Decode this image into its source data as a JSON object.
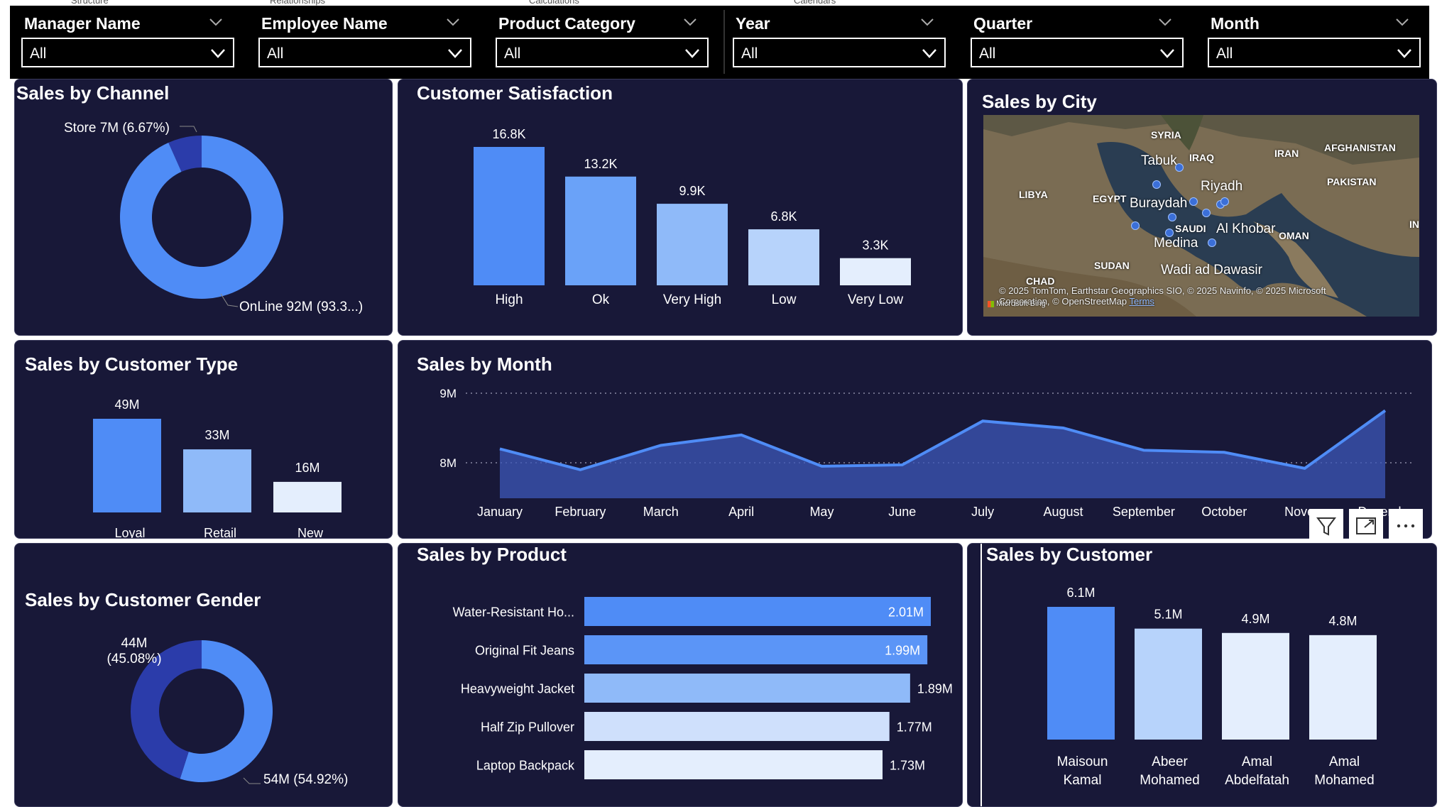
{
  "top_tabs": [
    "Structure",
    "Relationships",
    "Calculations",
    "Calendars"
  ],
  "filters": [
    {
      "label": "Manager Name",
      "value": "All"
    },
    {
      "label": "Employee Name",
      "value": "All"
    },
    {
      "label": "Product Category",
      "value": "All"
    },
    {
      "label": "Year",
      "value": "All"
    },
    {
      "label": "Quarter",
      "value": "All"
    },
    {
      "label": "Month",
      "value": "All"
    }
  ],
  "sales_by_channel": {
    "title": "Sales by Channel",
    "chart_data": {
      "type": "pie",
      "labels": [
        "Store 7M (6.67%)",
        "OnLine 92M (93.3...)"
      ],
      "values": [
        6.67,
        93.33
      ],
      "colors": [
        "#2b3caa",
        "#4f8cf6"
      ]
    }
  },
  "customer_satisfaction": {
    "title": "Customer Satisfaction",
    "chart_data": {
      "type": "bar",
      "categories": [
        "High",
        "Ok",
        "Very High",
        "Low",
        "Very Low"
      ],
      "values": [
        16.8,
        13.2,
        9.9,
        6.8,
        3.3
      ],
      "data_labels": [
        "16.8K",
        "13.2K",
        "9.9K",
        "6.8K",
        "3.3K"
      ],
      "colors": [
        "#4f8cf6",
        "#6aa2f8",
        "#8fbaf9",
        "#b7d3fb",
        "#e4eefd"
      ]
    }
  },
  "sales_by_city": {
    "title": "Sales by City",
    "countries": [
      "SYRIA",
      "IRAQ",
      "IRAN",
      "AFGHANISTAN",
      "LIBYA",
      "EGYPT",
      "PAKISTAN",
      "SAUDI",
      "OMAN",
      "SUDAN",
      "CHAD",
      "IN"
    ],
    "cities": [
      "Tabuk",
      "Riyadh",
      "Buraydah",
      "Al Khobar",
      "Medina",
      "Wadi ad Dawasir"
    ],
    "attribution": "© 2025 TomTom, Earthstar Geographics SIO, © 2025 Navinfo, © 2025 Microsoft Corporation, © OpenStreetMap",
    "attribution_terms": "Terms",
    "bing": "Microsoft Bing"
  },
  "sales_by_customer_type": {
    "title": "Sales by Customer Type",
    "chart_data": {
      "type": "bar",
      "categories": [
        "Loyal Customer",
        "Retail Customer",
        "New Customer"
      ],
      "values": [
        49,
        33,
        16
      ],
      "data_labels": [
        "49M",
        "33M",
        "16M"
      ],
      "colors": [
        "#4f8cf6",
        "#8fbaf9",
        "#e4eefd"
      ]
    }
  },
  "sales_by_month": {
    "title": "Sales by Month",
    "chart_data": {
      "type": "area",
      "categories": [
        "January",
        "February",
        "March",
        "April",
        "May",
        "June",
        "July",
        "August",
        "September",
        "October",
        "November",
        "December"
      ],
      "category_labels": [
        "January",
        "February",
        "March",
        "April",
        "May",
        "June",
        "July",
        "August",
        "September",
        "October",
        "Novem",
        "Decembe"
      ],
      "values": [
        8.2,
        7.9,
        8.25,
        8.4,
        7.95,
        7.97,
        8.6,
        8.5,
        8.18,
        8.15,
        7.92,
        8.75
      ],
      "ytick_labels": [
        "9M",
        "8M"
      ],
      "ytick_values": [
        9,
        8
      ],
      "ylim": [
        7.5,
        9.0
      ],
      "color": "#4f8cf6"
    }
  },
  "sales_by_customer_gender": {
    "title": "Sales by Customer Gender",
    "chart_data": {
      "type": "pie",
      "labels": [
        "44M (45.08%)",
        "54M (54.92%)"
      ],
      "label_lines": [
        [
          "44M",
          "(45.08%)"
        ],
        [
          "54M (54.92%)"
        ]
      ],
      "values": [
        45.08,
        54.92
      ],
      "colors": [
        "#2b3caa",
        "#4f8cf6"
      ]
    }
  },
  "sales_by_product": {
    "title": "Sales by Product",
    "chart_data": {
      "type": "bar",
      "orientation": "horizontal",
      "categories": [
        "Water-Resistant Ho...",
        "Original Fit Jeans",
        "Heavyweight Jacket",
        "Half Zip Pullover",
        "Laptop Backpack"
      ],
      "values": [
        2.01,
        1.99,
        1.89,
        1.77,
        1.73
      ],
      "data_labels": [
        "2.01M",
        "1.99M",
        "1.89M",
        "1.77M",
        "1.73M"
      ],
      "colors": [
        "#4f8cf6",
        "#5b95f7",
        "#8fbaf9",
        "#cfe0fc",
        "#e4eefd"
      ]
    }
  },
  "sales_by_customer": {
    "title": "Sales by Customer",
    "chart_data": {
      "type": "bar",
      "categories": [
        "Maisoun Kamal",
        "Abeer Mohamed",
        "Amal Abdelfatah",
        "Amal Mohamed"
      ],
      "category_lines": [
        [
          "Maisoun",
          "Kamal"
        ],
        [
          "Abeer",
          "Mohamed"
        ],
        [
          "Amal",
          "Abdelfatah"
        ],
        [
          "Amal",
          "Mohamed"
        ]
      ],
      "values": [
        6.1,
        5.1,
        4.9,
        4.8
      ],
      "data_labels": [
        "6.1M",
        "5.1M",
        "4.9M",
        "4.8M"
      ],
      "colors": [
        "#4f8cf6",
        "#b7d3fb",
        "#e4eefd",
        "#e4eefd"
      ]
    }
  },
  "visual_toolbar": [
    "filter-icon",
    "focus-mode-icon",
    "more-options-icon"
  ]
}
